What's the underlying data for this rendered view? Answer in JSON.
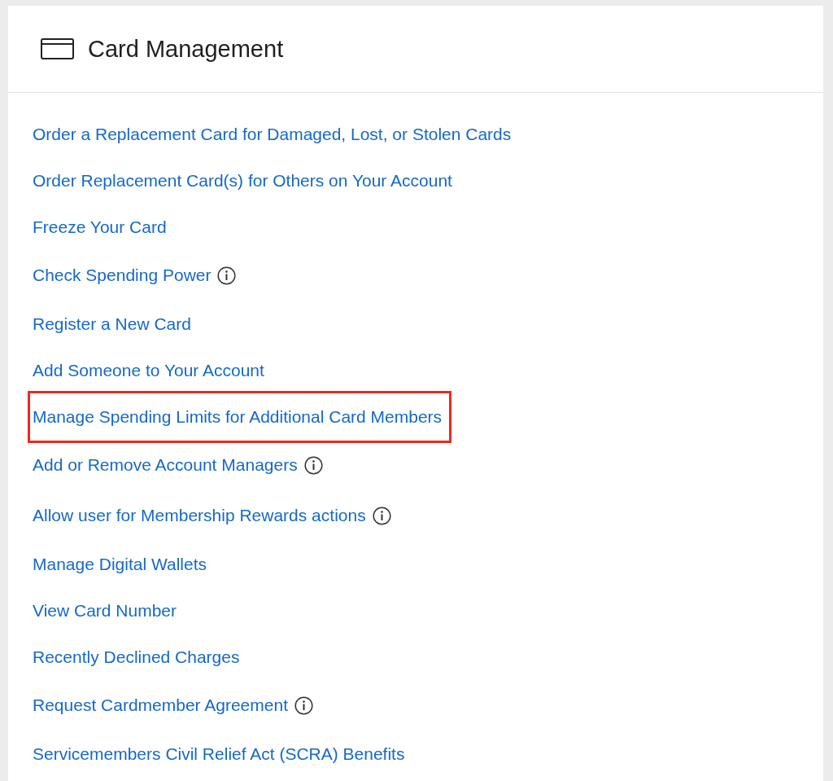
{
  "panel": {
    "title": "Card Management"
  },
  "links": [
    {
      "label": "Order a Replacement Card for Damaged, Lost, or Stolen Cards",
      "info": false,
      "highlighted": false
    },
    {
      "label": "Order Replacement Card(s) for Others on Your Account",
      "info": false,
      "highlighted": false
    },
    {
      "label": "Freeze Your Card",
      "info": false,
      "highlighted": false
    },
    {
      "label": "Check Spending Power",
      "info": true,
      "highlighted": false
    },
    {
      "label": "Register a New Card",
      "info": false,
      "highlighted": false
    },
    {
      "label": "Add Someone to Your Account",
      "info": false,
      "highlighted": false
    },
    {
      "label": "Manage Spending Limits for Additional Card Members",
      "info": false,
      "highlighted": true
    },
    {
      "label": "Add or Remove Account Managers",
      "info": true,
      "highlighted": false
    },
    {
      "label": "Allow user for Membership Rewards actions",
      "info": true,
      "highlighted": false
    },
    {
      "label": "Manage Digital Wallets",
      "info": false,
      "highlighted": false
    },
    {
      "label": "View Card Number",
      "info": false,
      "highlighted": false
    },
    {
      "label": "Recently Declined Charges",
      "info": false,
      "highlighted": false
    },
    {
      "label": "Request Cardmember Agreement",
      "info": true,
      "highlighted": false
    },
    {
      "label": "Servicemembers Civil Relief Act (SCRA) Benefits",
      "info": false,
      "highlighted": false
    }
  ]
}
